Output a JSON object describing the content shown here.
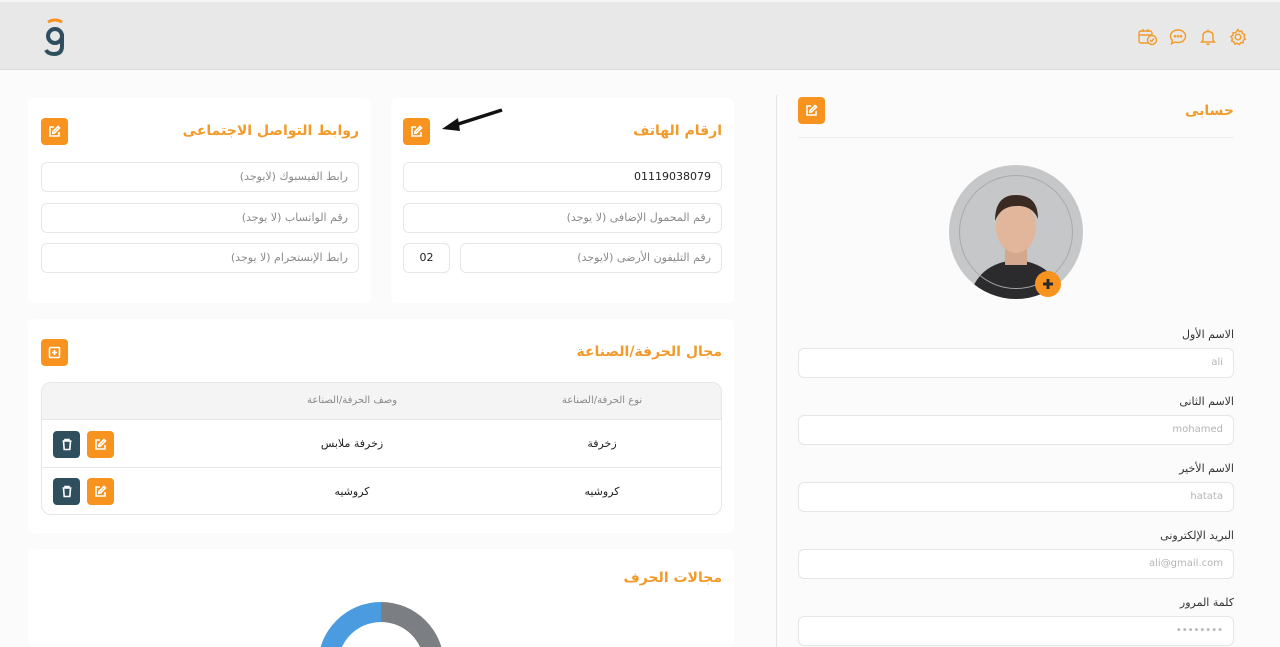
{
  "header": {
    "icons": [
      "settings-icon",
      "bell-icon",
      "chat-icon",
      "calendar-check-icon"
    ]
  },
  "account": {
    "title": "حسابى",
    "fields": [
      {
        "label": "الاسم الأول",
        "value": "ali"
      },
      {
        "label": "الاسم الثانى",
        "value": "mohamed"
      },
      {
        "label": "الاسم الأخير",
        "value": "hatata"
      },
      {
        "label": "البريد الإلكترونى",
        "value": "ali@gmail.com"
      },
      {
        "label": "كلمة المرور",
        "value": "••••••••"
      }
    ]
  },
  "phones": {
    "title": "ارقام الهاتف",
    "mobile": "01119038079",
    "extra_mobile_placeholder": "رقم المحمول الإضافى (لا يوجد)",
    "landline_placeholder": "رقم التليفون الأرضى (لايوجد)",
    "area_code": "02"
  },
  "social": {
    "title": "روابط التواصل الاجتماعى",
    "facebook_placeholder": "رابط الفيسبوك (لايوجد)",
    "whatsapp_placeholder": "رقم الواتساب (لا يوجد)",
    "instagram_placeholder": "رابط الإنستجرام (لا يوجد)"
  },
  "craft": {
    "title": "مجال الحرفة/الصناعة",
    "columns": [
      "نوع الحرفة/الصناعة",
      "وصف الحرفة/الصناعة"
    ],
    "rows": [
      {
        "type": "زخرفة",
        "description": "زخرفة ملابس"
      },
      {
        "type": "كروشيه",
        "description": "كروشيه"
      }
    ]
  },
  "craft_fields": {
    "title": "مجالات الحرف",
    "segments": [
      {
        "color": "#7b7e83"
      },
      {
        "color": "#4a9be0"
      }
    ]
  },
  "colors": {
    "accent": "#f7931e",
    "title": "#f29b2b",
    "dark_button": "#2f4f5f"
  }
}
